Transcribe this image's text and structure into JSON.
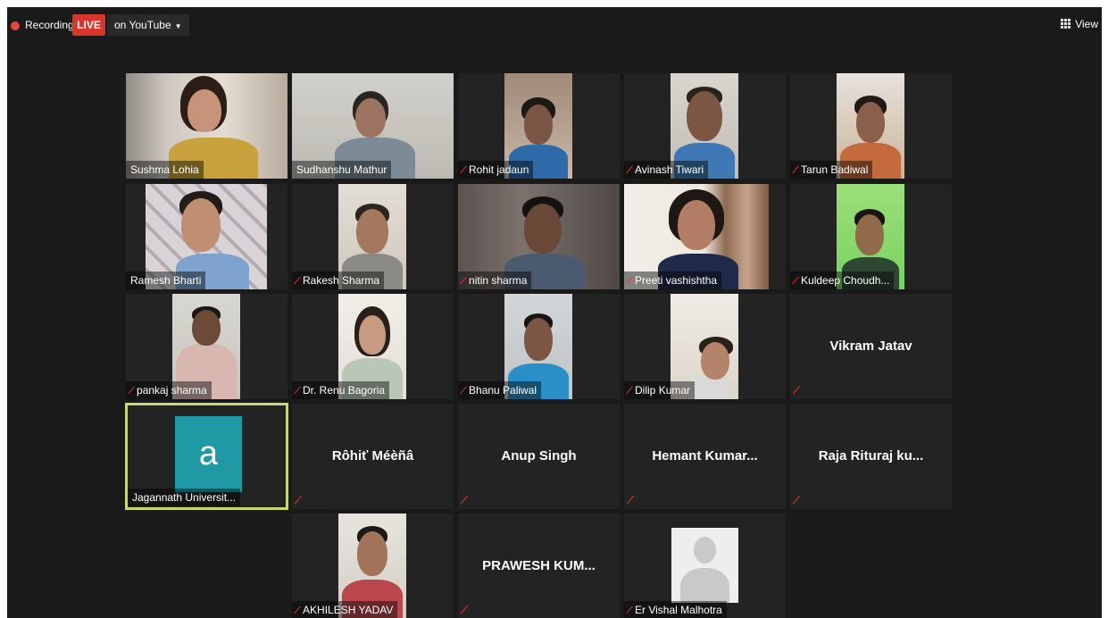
{
  "topbar": {
    "recording_label": "Recording",
    "live_label": "LIVE",
    "stream_label": "on YouTube",
    "view_label": "View"
  },
  "participants": [
    {
      "name": "Sushma Lohia",
      "muted": false
    },
    {
      "name": "Sudhanshu Mathur",
      "muted": false
    },
    {
      "name": "Rohit jadaun",
      "muted": true
    },
    {
      "name": "Avinash Tiwari",
      "muted": true
    },
    {
      "name": "Tarun Badiwal",
      "muted": true
    },
    {
      "name": "Ramesh Bharti",
      "muted": false
    },
    {
      "name": "Rakesh Sharma",
      "muted": true
    },
    {
      "name": "nitin sharma",
      "muted": true
    },
    {
      "name": "Preeti vashishtha",
      "muted": true
    },
    {
      "name": "Kuldeep Choudh...",
      "muted": true
    },
    {
      "name": "pankaj sharma",
      "muted": true
    },
    {
      "name": "Dr. Renu Bagoria",
      "muted": true
    },
    {
      "name": "Bhanu Paliwal",
      "muted": true
    },
    {
      "name": "Dilip Kumar",
      "muted": true
    },
    {
      "name": "Vikram Jatav",
      "muted": true,
      "video_off": true
    },
    {
      "name": "Jagannath Universit...",
      "muted": false,
      "avatar_letter": "a",
      "active_speaker": true
    },
    {
      "name": "Rôhiť Méèñâ",
      "muted": true,
      "video_off": true
    },
    {
      "name": "Anup Singh",
      "muted": true,
      "video_off": true
    },
    {
      "name": "Hemant  Kumar...",
      "muted": true,
      "video_off": true
    },
    {
      "name": "Raja Rituraj ku...",
      "muted": true,
      "video_off": true
    },
    {
      "name": "AKHILESH YADAV",
      "muted": true
    },
    {
      "name": "PRAWESH KUM...",
      "muted": true,
      "video_off": true
    },
    {
      "name": "Er Vishal Malhotra",
      "muted": true,
      "default_avatar": true
    }
  ],
  "colors": {
    "background": "#1a1a1a",
    "tile": "#232323",
    "live": "#d9352c",
    "muted_icon": "#e5352d",
    "active_speaker_border": "#c9d86f",
    "avatar_teal": "#1f9aa5"
  },
  "icons": {
    "muted": "microphone-muted-icon",
    "view": "grid-icon",
    "recording": "recording-dot-icon",
    "dropdown": "caret-down-icon"
  }
}
